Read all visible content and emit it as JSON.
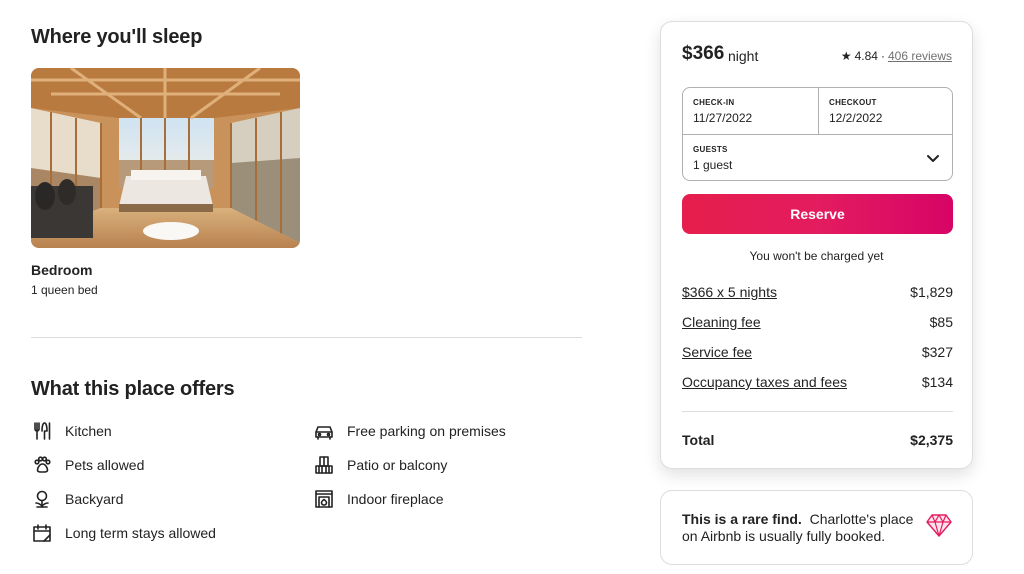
{
  "sleep": {
    "title": "Where you'll sleep",
    "room_name": "Bedroom",
    "room_beds": "1 queen bed"
  },
  "offers": {
    "title": "What this place offers",
    "amenities": [
      {
        "label": "Kitchen",
        "icon": "kitchen-icon"
      },
      {
        "label": "Free parking on premises",
        "icon": "car-icon"
      },
      {
        "label": "Pets allowed",
        "icon": "paw-icon"
      },
      {
        "label": "Patio or balcony",
        "icon": "balcony-icon"
      },
      {
        "label": "Backyard",
        "icon": "tree-icon"
      },
      {
        "label": "Indoor fireplace",
        "icon": "fireplace-icon"
      },
      {
        "label": "Long term stays allowed",
        "icon": "calendar-icon"
      }
    ]
  },
  "booking": {
    "price": "$366",
    "price_unit": "night",
    "rating": "4.84",
    "reviews": "406 reviews",
    "checkin_label": "CHECK-IN",
    "checkin_value": "11/27/2022",
    "checkout_label": "CHECKOUT",
    "checkout_value": "12/2/2022",
    "guests_label": "GUESTS",
    "guests_value": "1 guest",
    "reserve_label": "Reserve",
    "no_charge_note": "You won't be charged yet",
    "lines": [
      {
        "label": "$366 x 5 nights",
        "amount": "$1,829"
      },
      {
        "label": "Cleaning fee",
        "amount": "$85"
      },
      {
        "label": "Service fee",
        "amount": "$327"
      },
      {
        "label": "Occupancy taxes and fees",
        "amount": "$134"
      }
    ],
    "total_label": "Total",
    "total_amount": "$2,375",
    "accent_color": "#e31c5f"
  },
  "rare_find": {
    "bold": "This is a rare find.",
    "text": "Charlotte's place on Airbnb is usually fully booked."
  }
}
